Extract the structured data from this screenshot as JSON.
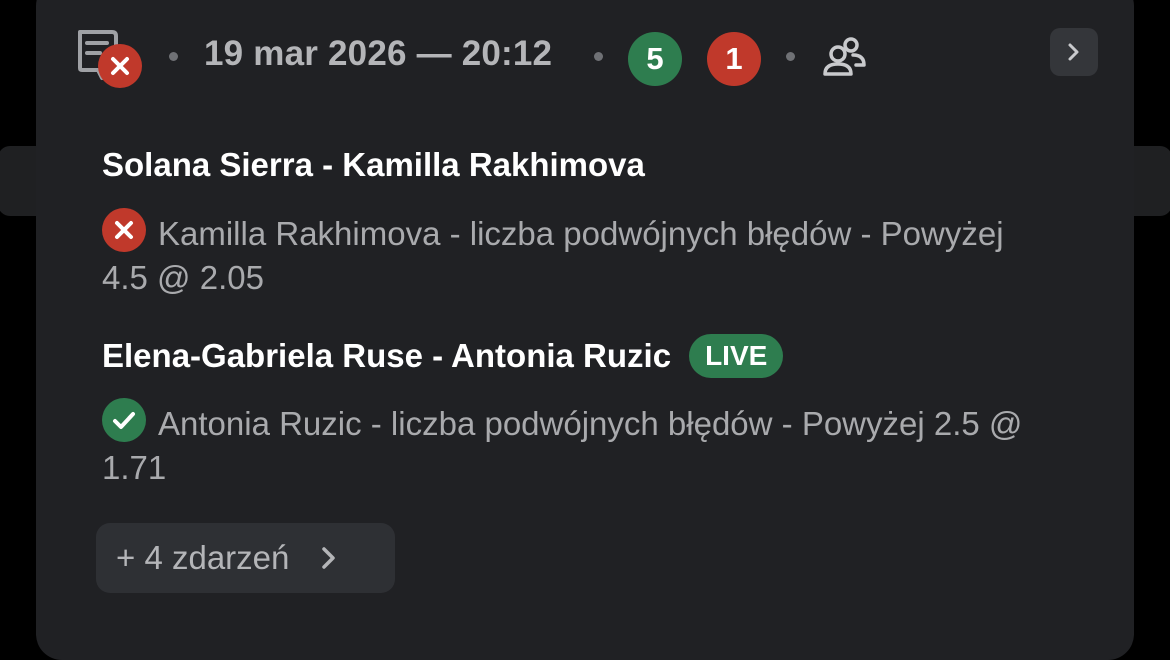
{
  "header": {
    "date_time": "19 mar 2026 — 20:12",
    "won_count": "5",
    "lost_count": "1",
    "ticket_icon": "ticket-lost-icon",
    "people_icon": "people-icon",
    "next_icon": "chevron-right-icon"
  },
  "events": [
    {
      "match": "Solana Sierra - Kamilla Rakhimova",
      "status": "lost",
      "bet": "Kamilla Rakhimova -  liczba podwójnych błędów - Powyżej 4.5 @ 2.05",
      "live": ""
    },
    {
      "match": "Elena-Gabriela Ruse - Antonia Ruzic",
      "status": "won",
      "bet": "Antonia Ruzic -  liczba podwójnych błędów - Powyżej 2.5 @ 1.71",
      "live": "LIVE"
    }
  ],
  "more_button": {
    "label": "+ 4 zdarzeń"
  },
  "colors": {
    "card_bg": "#202124",
    "won": "#2e7d4f",
    "lost": "#c0392b",
    "muted_text": "#a9aaad"
  }
}
